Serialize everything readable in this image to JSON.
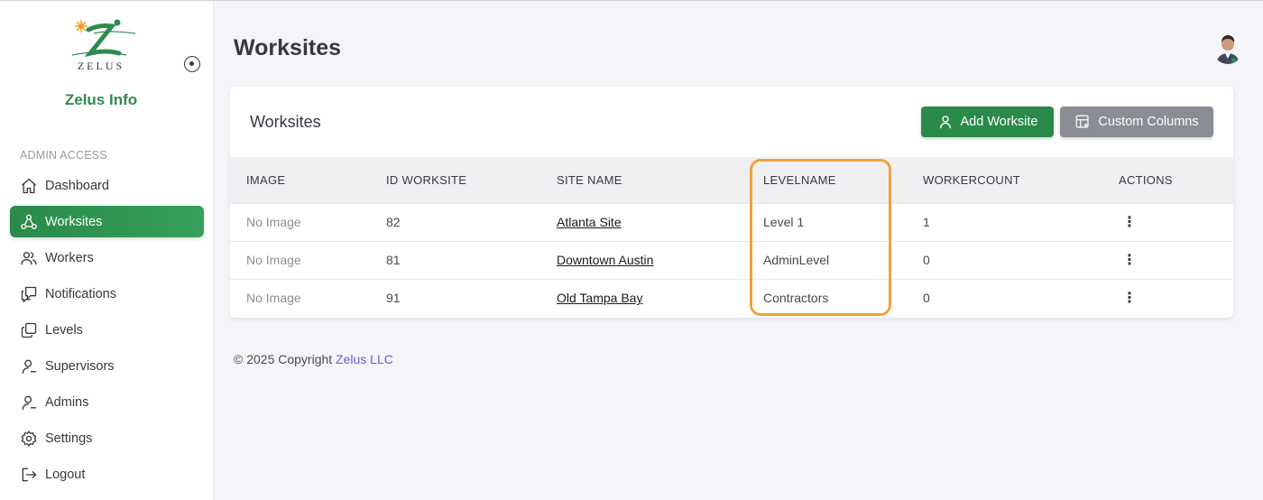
{
  "brand": {
    "name": "Zelus Info",
    "logo_text": "ZELUS"
  },
  "sidebar": {
    "section_label": "ADMIN ACCESS",
    "items": [
      {
        "label": "Dashboard",
        "icon": "home-icon"
      },
      {
        "label": "Worksites",
        "icon": "network-icon"
      },
      {
        "label": "Workers",
        "icon": "users-icon"
      },
      {
        "label": "Notifications",
        "icon": "notification-icon"
      },
      {
        "label": "Levels",
        "icon": "layers-icon"
      },
      {
        "label": "Supervisors",
        "icon": "user-icon"
      },
      {
        "label": "Admins",
        "icon": "user-icon"
      },
      {
        "label": "Settings",
        "icon": "gear-icon"
      },
      {
        "label": "Logout",
        "icon": "logout-icon"
      }
    ],
    "active_index": 1
  },
  "header": {
    "title": "Worksites"
  },
  "card": {
    "title": "Worksites",
    "add_button": "Add Worksite",
    "columns_button": "Custom Columns"
  },
  "table": {
    "headers": [
      "IMAGE",
      "ID WORKSITE",
      "SITE NAME",
      "LEVELNAME",
      "WORKERCOUNT",
      "ACTIONS"
    ],
    "rows": [
      {
        "image": "No Image",
        "id": "82",
        "site": "Atlanta Site",
        "level": "Level 1",
        "workers": "1",
        "action": "⋮"
      },
      {
        "image": "No Image",
        "id": "81",
        "site": "Downtown Austin",
        "level": "AdminLevel",
        "workers": "0",
        "action": "⋮"
      },
      {
        "image": "No Image",
        "id": "91",
        "site": "Old Tampa Bay",
        "level": "Contractors",
        "workers": "0",
        "action": "⋮"
      }
    ]
  },
  "footer": {
    "copyright": "© 2025 Copyright",
    "company": "Zelus LLC"
  },
  "colors": {
    "accent_green": "#2a8a4a",
    "highlight_orange": "#f2a23a",
    "link_purple": "#6a5ae0"
  }
}
